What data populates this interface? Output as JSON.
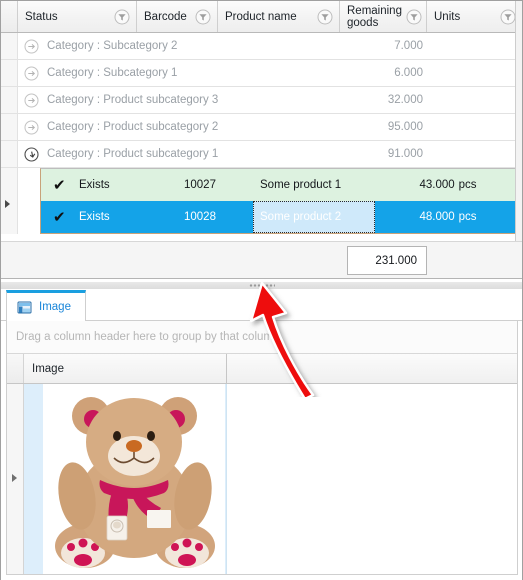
{
  "top_grid": {
    "columns": [
      {
        "label": "Status",
        "filter_icon": "funnel-icon"
      },
      {
        "label": "Barcode",
        "filter_icon": "funnel-icon"
      },
      {
        "label": "Product name",
        "filter_icon": "funnel-icon"
      },
      {
        "label": "Remaining\ngoods",
        "filter_icon": "funnel-icon"
      },
      {
        "label": "Units",
        "filter_icon": "funnel-icon"
      }
    ],
    "group_rows": [
      {
        "label": "Category : Subcategory 2",
        "value": "7.000",
        "expanded": false,
        "icon": "arrow-right-circle-icon"
      },
      {
        "label": "Category : Subcategory 1",
        "value": "6.000",
        "expanded": false,
        "icon": "arrow-right-circle-icon"
      },
      {
        "label": "Category : Product subcategory 3",
        "value": "32.000",
        "expanded": false,
        "icon": "arrow-right-circle-icon"
      },
      {
        "label": "Category : Product subcategory 2",
        "value": "95.000",
        "expanded": false,
        "icon": "arrow-right-circle-icon"
      },
      {
        "label": "Category : Product subcategory 1",
        "value": "91.000",
        "expanded": true,
        "icon": "arrow-down-right-circle-icon"
      }
    ],
    "detail_rows": [
      {
        "check": "✔",
        "status": "Exists",
        "barcode": "10027",
        "product": "Some product 1",
        "remaining": "43.000",
        "units": "pcs",
        "selected": false,
        "focused_cell": false
      },
      {
        "check": "✔",
        "status": "Exists",
        "barcode": "10028",
        "product": "Some product 2",
        "remaining": "48.000",
        "units": "pcs",
        "selected": true,
        "focused_cell": true
      }
    ],
    "summary_total": "231.000",
    "colors": {
      "row_new": "#ddf2e0",
      "row_selected": "#14a3e8",
      "focused_cell": "#cfe9fa",
      "accent": "#1a9fe0"
    }
  },
  "splitter": {
    "grip": "splitter-grip"
  },
  "bottom_panel": {
    "tab": {
      "label": "Image",
      "icon": "image-tab-icon",
      "active": true
    },
    "group_band_text": "Drag a column header here to group by that column",
    "column_header": "Image",
    "image_alt": "teddy-bear-photo"
  },
  "annotation": {
    "arrow": "red-callout-arrow",
    "color": "#ee1111"
  }
}
